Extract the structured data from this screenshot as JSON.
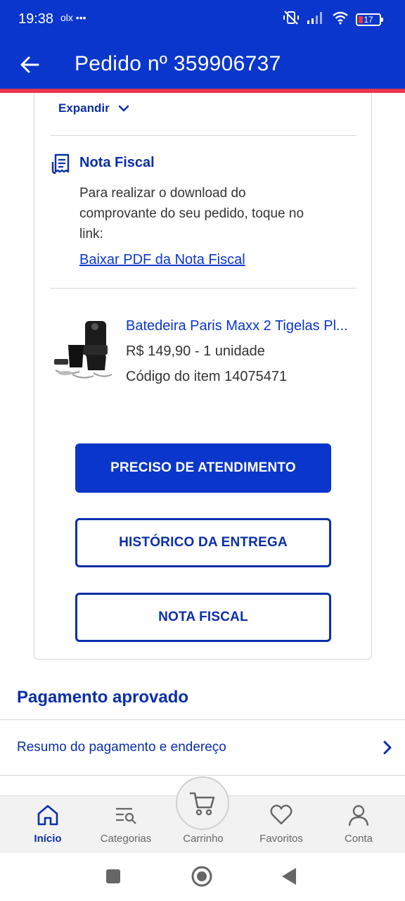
{
  "status_bar": {
    "time": "19:38",
    "extra": "olx •••",
    "battery": "17",
    "battery_level": 0.17
  },
  "header": {
    "title": "Pedido nº 359906737",
    "back_icon": "arrow-left-icon"
  },
  "card": {
    "expand_label": "Expandir",
    "nota_fiscal": {
      "title": "Nota Fiscal",
      "text": "Para realizar o download do comprovante do seu pedido, toque no link:",
      "link": "Baixar PDF da Nota Fiscal"
    },
    "product": {
      "name": "Batedeira Paris Maxx 2 Tigelas Pl...",
      "price": "R$ 149,90 - 1 unidade",
      "code": "Código do item 14075471"
    },
    "buttons": {
      "support": "PRECISO DE ATENDIMENTO",
      "history": "HISTÓRICO DA ENTREGA",
      "invoice": "NOTA FISCAL"
    }
  },
  "payment": {
    "title": "Pagamento aprovado",
    "summary": "Resumo do pagamento e endereço"
  },
  "bottom_nav": {
    "items": [
      {
        "label": "Início",
        "icon": "home-icon",
        "active": true
      },
      {
        "label": "Categorias",
        "icon": "categories-icon",
        "active": false
      },
      {
        "label": "Carrinho",
        "icon": "cart-icon",
        "active": false
      },
      {
        "label": "Favoritos",
        "icon": "heart-icon",
        "active": false
      },
      {
        "label": "Conta",
        "icon": "user-icon",
        "active": false
      }
    ]
  },
  "colors": {
    "brand": "#0a36cc",
    "accent": "#e8344e",
    "text_blue": "#0a2fa8"
  }
}
